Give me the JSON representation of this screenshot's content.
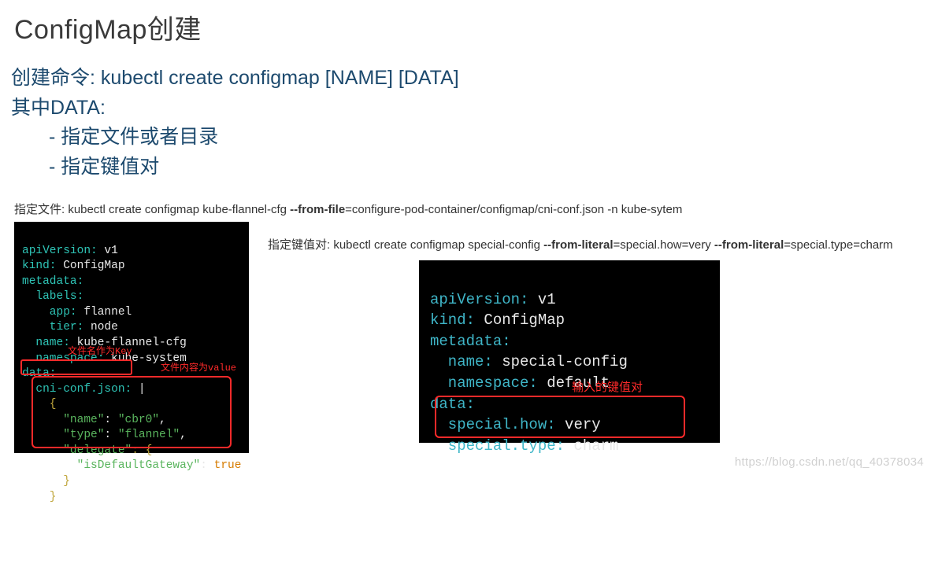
{
  "title": "ConfigMap创建",
  "intro": {
    "line1_prefix": "创建命令: ",
    "line1_cmd": "kubectl create configmap [NAME] [DATA]",
    "line2": "其中DATA:",
    "bullet1": "- 指定文件或者目录",
    "bullet2": "- 指定键值对"
  },
  "file_example": {
    "caption_prefix": "指定文件: kubectl create configmap kube-flannel-cfg  ",
    "caption_bold": "--from-file",
    "caption_suffix": "=configure-pod-container/configmap/cni-conf.json -n kube-sytem",
    "yaml": {
      "l1k": "apiVersion:",
      "l1v": " v1",
      "l2k": "kind:",
      "l2v": " ConfigMap",
      "l3k": "metadata:",
      "l4k": "  labels:",
      "l5k": "    app:",
      "l5v": " flannel",
      "l6k": "    tier:",
      "l6v": " node",
      "l7k": "  name:",
      "l7v": " kube-flannel-cfg",
      "l8k": "  namespace:",
      "l8v": " kube-system",
      "l9k": "data:",
      "l10k": "  cni-conf.json:",
      "l10v": " |",
      "j1": "    {",
      "j2a": "      \"name\"",
      "j2b": ": ",
      "j2c": "\"cbr0\"",
      "j2d": ",",
      "j3a": "      \"type\"",
      "j3b": ": ",
      "j3c": "\"flannel\"",
      "j3d": ",",
      "j4a": "      \"delegate\"",
      "j4b": ": {",
      "j5a": "        \"isDefaultGateway\"",
      "j5b": ": ",
      "j5c": "true",
      "j6": "      }",
      "j7": "    }"
    },
    "ann_key": "文件名作为Key",
    "ann_val": "文件内容为value"
  },
  "literal_example": {
    "caption_prefix": "指定键值对: kubectl create configmap special-config ",
    "caption_b1": "--from-literal",
    "caption_m1": "=special.how=very ",
    "caption_b2": "--from-literal",
    "caption_m2": "=special.type=charm",
    "yaml": {
      "l1k": "apiVersion:",
      "l1v": " v1",
      "l2k": "kind:",
      "l2v": " ConfigMap",
      "l3k": "metadata:",
      "l4k": "  name:",
      "l4v": " special-config",
      "l5k": "  namespace:",
      "l5v": " default",
      "l6k": "data:",
      "l7k": "  special.how:",
      "l7v": " very",
      "l8k": "  special.type:",
      "l8v": " charm"
    },
    "ann_kv": "输入的键值对"
  },
  "watermark": "https://blog.csdn.net/qq_40378034"
}
